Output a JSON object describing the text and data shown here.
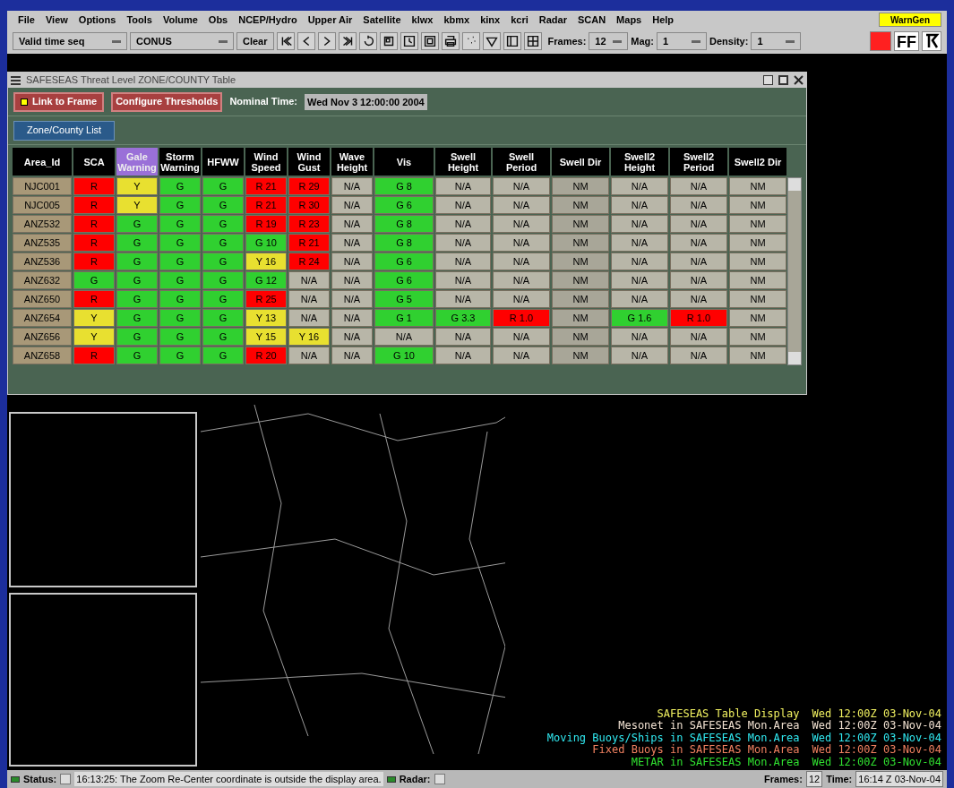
{
  "menu": [
    "File",
    "View",
    "Options",
    "Tools",
    "Volume",
    "Obs",
    "NCEP/Hydro",
    "Upper Air",
    "Satellite",
    "klwx",
    "kbmx",
    "kinx",
    "kcri",
    "Radar",
    "SCAN",
    "Maps",
    "Help"
  ],
  "warngen": "WarnGen",
  "toolbar": {
    "time_mode": "Valid time seq",
    "area": "CONUS",
    "clear": "Clear",
    "frames_label": "Frames:",
    "frames": "12",
    "mag_label": "Mag:",
    "mag": "1",
    "density_label": "Density:",
    "density": "1",
    "ff": "FF"
  },
  "table_window": {
    "title": "SAFESEAS Threat Level ZONE/COUNTY Table",
    "link_to_frame": {
      "label": "Link to Frame",
      "checked": true
    },
    "configure": "Configure Thresholds",
    "nominal_label": "Nominal Time:",
    "nominal_time": "Wed Nov  3 12:00:00 2004",
    "list_button": "Zone/County List",
    "columns": [
      {
        "label": "Area_Id",
        "selected": false
      },
      {
        "label": "SCA",
        "selected": false
      },
      {
        "label": "Gale Warning",
        "selected": true
      },
      {
        "label": "Storm Warning",
        "selected": false
      },
      {
        "label": "HFWW",
        "selected": false
      },
      {
        "label": "Wind Speed",
        "selected": false
      },
      {
        "label": "Wind Gust",
        "selected": false
      },
      {
        "label": "Wave Height",
        "selected": false
      },
      {
        "label": "Vis",
        "selected": false
      },
      {
        "label": "Swell Height",
        "selected": false
      },
      {
        "label": "Swell Period",
        "selected": false
      },
      {
        "label": "Swell Dir",
        "selected": false
      },
      {
        "label": "Swell2 Height",
        "selected": false
      },
      {
        "label": "Swell2 Period",
        "selected": false
      },
      {
        "label": "Swell2 Dir",
        "selected": false
      }
    ],
    "rows": [
      {
        "cells": [
          {
            "text": "NJC001",
            "color": "#a89878"
          },
          {
            "text": "R",
            "color": "#ff0000"
          },
          {
            "text": "Y",
            "color": "#e8e030"
          },
          {
            "text": "G",
            "color": "#30d030"
          },
          {
            "text": "G",
            "color": "#30d030"
          },
          {
            "text": "R 21",
            "color": "#ff0000"
          },
          {
            "text": "R 29",
            "color": "#ff0000"
          },
          {
            "text": "N/A",
            "color": "#b8b6a8"
          },
          {
            "text": "G 8",
            "color": "#30d030"
          },
          {
            "text": "N/A",
            "color": "#b8b6a8"
          },
          {
            "text": "N/A",
            "color": "#b8b6a8"
          },
          {
            "text": "NM",
            "color": "#a8a698"
          },
          {
            "text": "N/A",
            "color": "#b8b6a8"
          },
          {
            "text": "N/A",
            "color": "#b8b6a8"
          },
          {
            "text": "NM",
            "color": "#b8b6a8"
          }
        ]
      },
      {
        "cells": [
          {
            "text": "NJC005",
            "color": "#a89878"
          },
          {
            "text": "R",
            "color": "#ff0000"
          },
          {
            "text": "Y",
            "color": "#e8e030"
          },
          {
            "text": "G",
            "color": "#30d030"
          },
          {
            "text": "G",
            "color": "#30d030"
          },
          {
            "text": "R 21",
            "color": "#ff0000"
          },
          {
            "text": "R 30",
            "color": "#ff0000"
          },
          {
            "text": "N/A",
            "color": "#b8b6a8"
          },
          {
            "text": "G 6",
            "color": "#30d030"
          },
          {
            "text": "N/A",
            "color": "#b8b6a8"
          },
          {
            "text": "N/A",
            "color": "#b8b6a8"
          },
          {
            "text": "NM",
            "color": "#a8a698"
          },
          {
            "text": "N/A",
            "color": "#b8b6a8"
          },
          {
            "text": "N/A",
            "color": "#b8b6a8"
          },
          {
            "text": "NM",
            "color": "#b8b6a8"
          }
        ]
      },
      {
        "cells": [
          {
            "text": "ANZ532",
            "color": "#a89878"
          },
          {
            "text": "R",
            "color": "#ff0000"
          },
          {
            "text": "G",
            "color": "#30d030"
          },
          {
            "text": "G",
            "color": "#30d030"
          },
          {
            "text": "G",
            "color": "#30d030"
          },
          {
            "text": "R 19",
            "color": "#ff0000"
          },
          {
            "text": "R 23",
            "color": "#ff0000"
          },
          {
            "text": "N/A",
            "color": "#b8b6a8"
          },
          {
            "text": "G 8",
            "color": "#30d030"
          },
          {
            "text": "N/A",
            "color": "#b8b6a8"
          },
          {
            "text": "N/A",
            "color": "#b8b6a8"
          },
          {
            "text": "NM",
            "color": "#a8a698"
          },
          {
            "text": "N/A",
            "color": "#b8b6a8"
          },
          {
            "text": "N/A",
            "color": "#b8b6a8"
          },
          {
            "text": "NM",
            "color": "#b8b6a8"
          }
        ]
      },
      {
        "cells": [
          {
            "text": "ANZ535",
            "color": "#a89878"
          },
          {
            "text": "R",
            "color": "#ff0000"
          },
          {
            "text": "G",
            "color": "#30d030"
          },
          {
            "text": "G",
            "color": "#30d030"
          },
          {
            "text": "G",
            "color": "#30d030"
          },
          {
            "text": "G 10",
            "color": "#30d030"
          },
          {
            "text": "R 21",
            "color": "#ff0000"
          },
          {
            "text": "N/A",
            "color": "#b8b6a8"
          },
          {
            "text": "G 8",
            "color": "#30d030"
          },
          {
            "text": "N/A",
            "color": "#b8b6a8"
          },
          {
            "text": "N/A",
            "color": "#b8b6a8"
          },
          {
            "text": "NM",
            "color": "#a8a698"
          },
          {
            "text": "N/A",
            "color": "#b8b6a8"
          },
          {
            "text": "N/A",
            "color": "#b8b6a8"
          },
          {
            "text": "NM",
            "color": "#b8b6a8"
          }
        ]
      },
      {
        "cells": [
          {
            "text": "ANZ536",
            "color": "#a89878"
          },
          {
            "text": "R",
            "color": "#ff0000"
          },
          {
            "text": "G",
            "color": "#30d030"
          },
          {
            "text": "G",
            "color": "#30d030"
          },
          {
            "text": "G",
            "color": "#30d030"
          },
          {
            "text": "Y 16",
            "color": "#e8e030"
          },
          {
            "text": "R 24",
            "color": "#ff0000"
          },
          {
            "text": "N/A",
            "color": "#b8b6a8"
          },
          {
            "text": "G 6",
            "color": "#30d030"
          },
          {
            "text": "N/A",
            "color": "#b8b6a8"
          },
          {
            "text": "N/A",
            "color": "#b8b6a8"
          },
          {
            "text": "NM",
            "color": "#a8a698"
          },
          {
            "text": "N/A",
            "color": "#b8b6a8"
          },
          {
            "text": "N/A",
            "color": "#b8b6a8"
          },
          {
            "text": "NM",
            "color": "#b8b6a8"
          }
        ]
      },
      {
        "cells": [
          {
            "text": "ANZ632",
            "color": "#a89878"
          },
          {
            "text": "G",
            "color": "#30d030"
          },
          {
            "text": "G",
            "color": "#30d030"
          },
          {
            "text": "G",
            "color": "#30d030"
          },
          {
            "text": "G",
            "color": "#30d030"
          },
          {
            "text": "G 12",
            "color": "#30d030"
          },
          {
            "text": "N/A",
            "color": "#b8b6a8"
          },
          {
            "text": "N/A",
            "color": "#b8b6a8"
          },
          {
            "text": "G 6",
            "color": "#30d030"
          },
          {
            "text": "N/A",
            "color": "#b8b6a8"
          },
          {
            "text": "N/A",
            "color": "#b8b6a8"
          },
          {
            "text": "NM",
            "color": "#a8a698"
          },
          {
            "text": "N/A",
            "color": "#b8b6a8"
          },
          {
            "text": "N/A",
            "color": "#b8b6a8"
          },
          {
            "text": "NM",
            "color": "#b8b6a8"
          }
        ]
      },
      {
        "cells": [
          {
            "text": "ANZ650",
            "color": "#a89878"
          },
          {
            "text": "R",
            "color": "#ff0000"
          },
          {
            "text": "G",
            "color": "#30d030"
          },
          {
            "text": "G",
            "color": "#30d030"
          },
          {
            "text": "G",
            "color": "#30d030"
          },
          {
            "text": "R 25",
            "color": "#ff0000"
          },
          {
            "text": "N/A",
            "color": "#b8b6a8"
          },
          {
            "text": "N/A",
            "color": "#b8b6a8"
          },
          {
            "text": "G 5",
            "color": "#30d030"
          },
          {
            "text": "N/A",
            "color": "#b8b6a8"
          },
          {
            "text": "N/A",
            "color": "#b8b6a8"
          },
          {
            "text": "NM",
            "color": "#a8a698"
          },
          {
            "text": "N/A",
            "color": "#b8b6a8"
          },
          {
            "text": "N/A",
            "color": "#b8b6a8"
          },
          {
            "text": "NM",
            "color": "#b8b6a8"
          }
        ]
      },
      {
        "cells": [
          {
            "text": "ANZ654",
            "color": "#a89878"
          },
          {
            "text": "Y",
            "color": "#e8e030"
          },
          {
            "text": "G",
            "color": "#30d030"
          },
          {
            "text": "G",
            "color": "#30d030"
          },
          {
            "text": "G",
            "color": "#30d030"
          },
          {
            "text": "Y 13",
            "color": "#e8e030"
          },
          {
            "text": "N/A",
            "color": "#b8b6a8"
          },
          {
            "text": "N/A",
            "color": "#b8b6a8"
          },
          {
            "text": "G 1",
            "color": "#30d030"
          },
          {
            "text": "G 3.3",
            "color": "#30d030"
          },
          {
            "text": "R 1.0",
            "color": "#ff0000"
          },
          {
            "text": "NM",
            "color": "#a8a698"
          },
          {
            "text": "G 1.6",
            "color": "#30d030"
          },
          {
            "text": "R 1.0",
            "color": "#ff0000"
          },
          {
            "text": "NM",
            "color": "#b8b6a8"
          }
        ]
      },
      {
        "cells": [
          {
            "text": "ANZ656",
            "color": "#a89878"
          },
          {
            "text": "Y",
            "color": "#e8e030"
          },
          {
            "text": "G",
            "color": "#30d030"
          },
          {
            "text": "G",
            "color": "#30d030"
          },
          {
            "text": "G",
            "color": "#30d030"
          },
          {
            "text": "Y 15",
            "color": "#e8e030"
          },
          {
            "text": "Y 16",
            "color": "#e8e030"
          },
          {
            "text": "N/A",
            "color": "#b8b6a8"
          },
          {
            "text": "N/A",
            "color": "#b8b6a8"
          },
          {
            "text": "N/A",
            "color": "#b8b6a8"
          },
          {
            "text": "N/A",
            "color": "#b8b6a8"
          },
          {
            "text": "NM",
            "color": "#a8a698"
          },
          {
            "text": "N/A",
            "color": "#b8b6a8"
          },
          {
            "text": "N/A",
            "color": "#b8b6a8"
          },
          {
            "text": "NM",
            "color": "#b8b6a8"
          }
        ]
      },
      {
        "cells": [
          {
            "text": "ANZ658",
            "color": "#a89878"
          },
          {
            "text": "R",
            "color": "#ff0000"
          },
          {
            "text": "G",
            "color": "#30d030"
          },
          {
            "text": "G",
            "color": "#30d030"
          },
          {
            "text": "G",
            "color": "#30d030"
          },
          {
            "text": "R 20",
            "color": "#ff0000"
          },
          {
            "text": "N/A",
            "color": "#b8b6a8"
          },
          {
            "text": "N/A",
            "color": "#b8b6a8"
          },
          {
            "text": "G 10",
            "color": "#30d030"
          },
          {
            "text": "N/A",
            "color": "#b8b6a8"
          },
          {
            "text": "N/A",
            "color": "#b8b6a8"
          },
          {
            "text": "NM",
            "color": "#a8a698"
          },
          {
            "text": "N/A",
            "color": "#b8b6a8"
          },
          {
            "text": "N/A",
            "color": "#b8b6a8"
          },
          {
            "text": "NM",
            "color": "#b8b6a8"
          }
        ]
      }
    ]
  },
  "legend": [
    {
      "label": "SAFESEAS Table Display",
      "time": "Wed 12:00Z 03-Nov-04",
      "color": "#f0f060"
    },
    {
      "label": "Mesonet in SAFESEAS Mon.Area",
      "time": "Wed 12:00Z 03-Nov-04",
      "color": "#f0e0d0"
    },
    {
      "label": "Moving Buoys/Ships in SAFESEAS Mon.Area",
      "time": "Wed 12:00Z 03-Nov-04",
      "color": "#30e8f0"
    },
    {
      "label": "Fixed Buoys in SAFESEAS Mon.Area",
      "time": "Wed 12:00Z 03-Nov-04",
      "color": "#f08060"
    },
    {
      "label": "METAR in SAFESEAS Mon.Area",
      "time": "Wed 12:00Z 03-Nov-04",
      "color": "#30e030"
    }
  ],
  "status_bar": {
    "status_label": "Status:",
    "message": "16:13:25: The Zoom Re-Center coordinate is outside the display area.",
    "radar_label": "Radar:",
    "frames_label": "Frames:",
    "frames": "12",
    "time_label": "Time:",
    "time": "16:14 Z 03-Nov-04"
  }
}
